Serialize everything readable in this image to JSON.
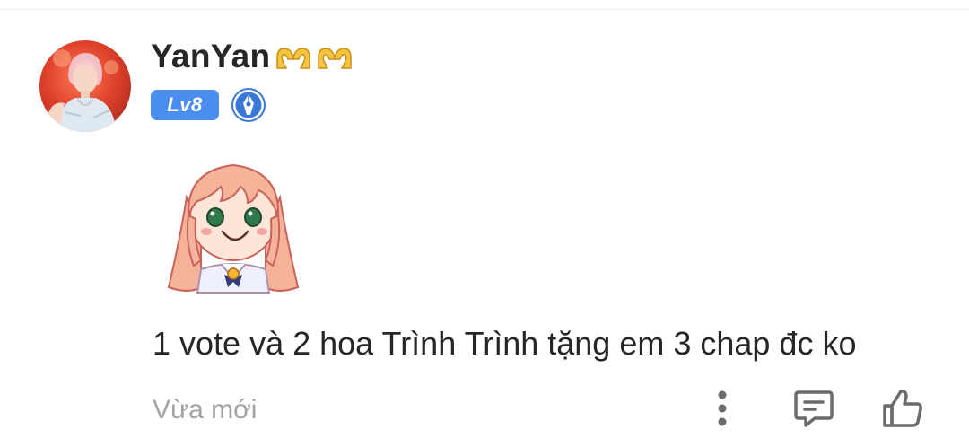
{
  "comment": {
    "username": "YanYan",
    "level_badge": "Lv8",
    "text": "1 vote và 2 hoa Trình Trình tặng em 3 chap đc ko",
    "timestamp": "Vừa mới"
  },
  "icons": {
    "username_emoji": [
      "heart-hands",
      "heart-hands"
    ],
    "badge": "writer-pen-badge",
    "actions": [
      "more-vertical-icon",
      "reply-comment-icon",
      "thumbs-up-icon"
    ]
  },
  "colors": {
    "text_primary": "#262626",
    "text_secondary": "#a3a3a3",
    "level_badge_bg": "#4a8ef0",
    "icon_gray": "#6b6b6b"
  }
}
